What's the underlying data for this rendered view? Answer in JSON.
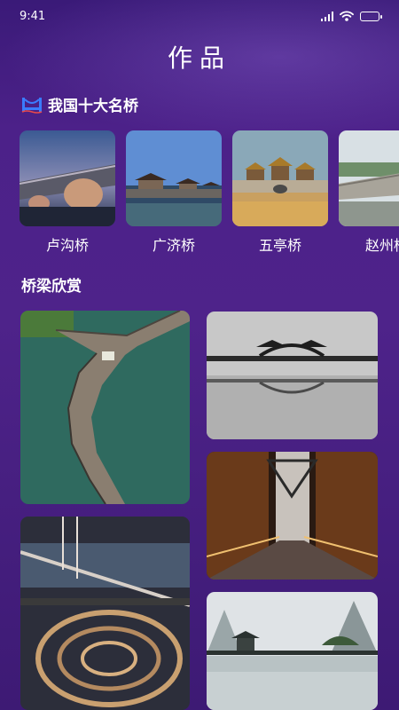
{
  "status_bar": {
    "time": "9:41",
    "icons": [
      "signal-icon",
      "wifi-icon",
      "battery-icon"
    ]
  },
  "page_title": "作品",
  "famous_bridges": {
    "title": "我国十大名桥",
    "icon": "bridge-icon",
    "items": [
      {
        "name": "卢沟桥",
        "image": "stone-arch-bridge-night-photo"
      },
      {
        "name": "广济桥",
        "image": "pavilion-bridge-photo"
      },
      {
        "name": "五亭桥",
        "image": "five-pavilion-bridge-photo"
      },
      {
        "name": "赵州桥",
        "image": "stone-bridge-photo"
      }
    ]
  },
  "gallery": {
    "title": "桥梁欣赏",
    "images": [
      "winding-boardwalk-photo",
      "grey-arch-bridge-reflection-photo",
      "lit-city-footbridge-photo",
      "interchange-cable-bridge-night-photo",
      "misty-pavilion-bridge-photo"
    ]
  },
  "colors": {
    "background": "#4c2189",
    "accent": "#3a7cff",
    "text": "#ffffff"
  }
}
